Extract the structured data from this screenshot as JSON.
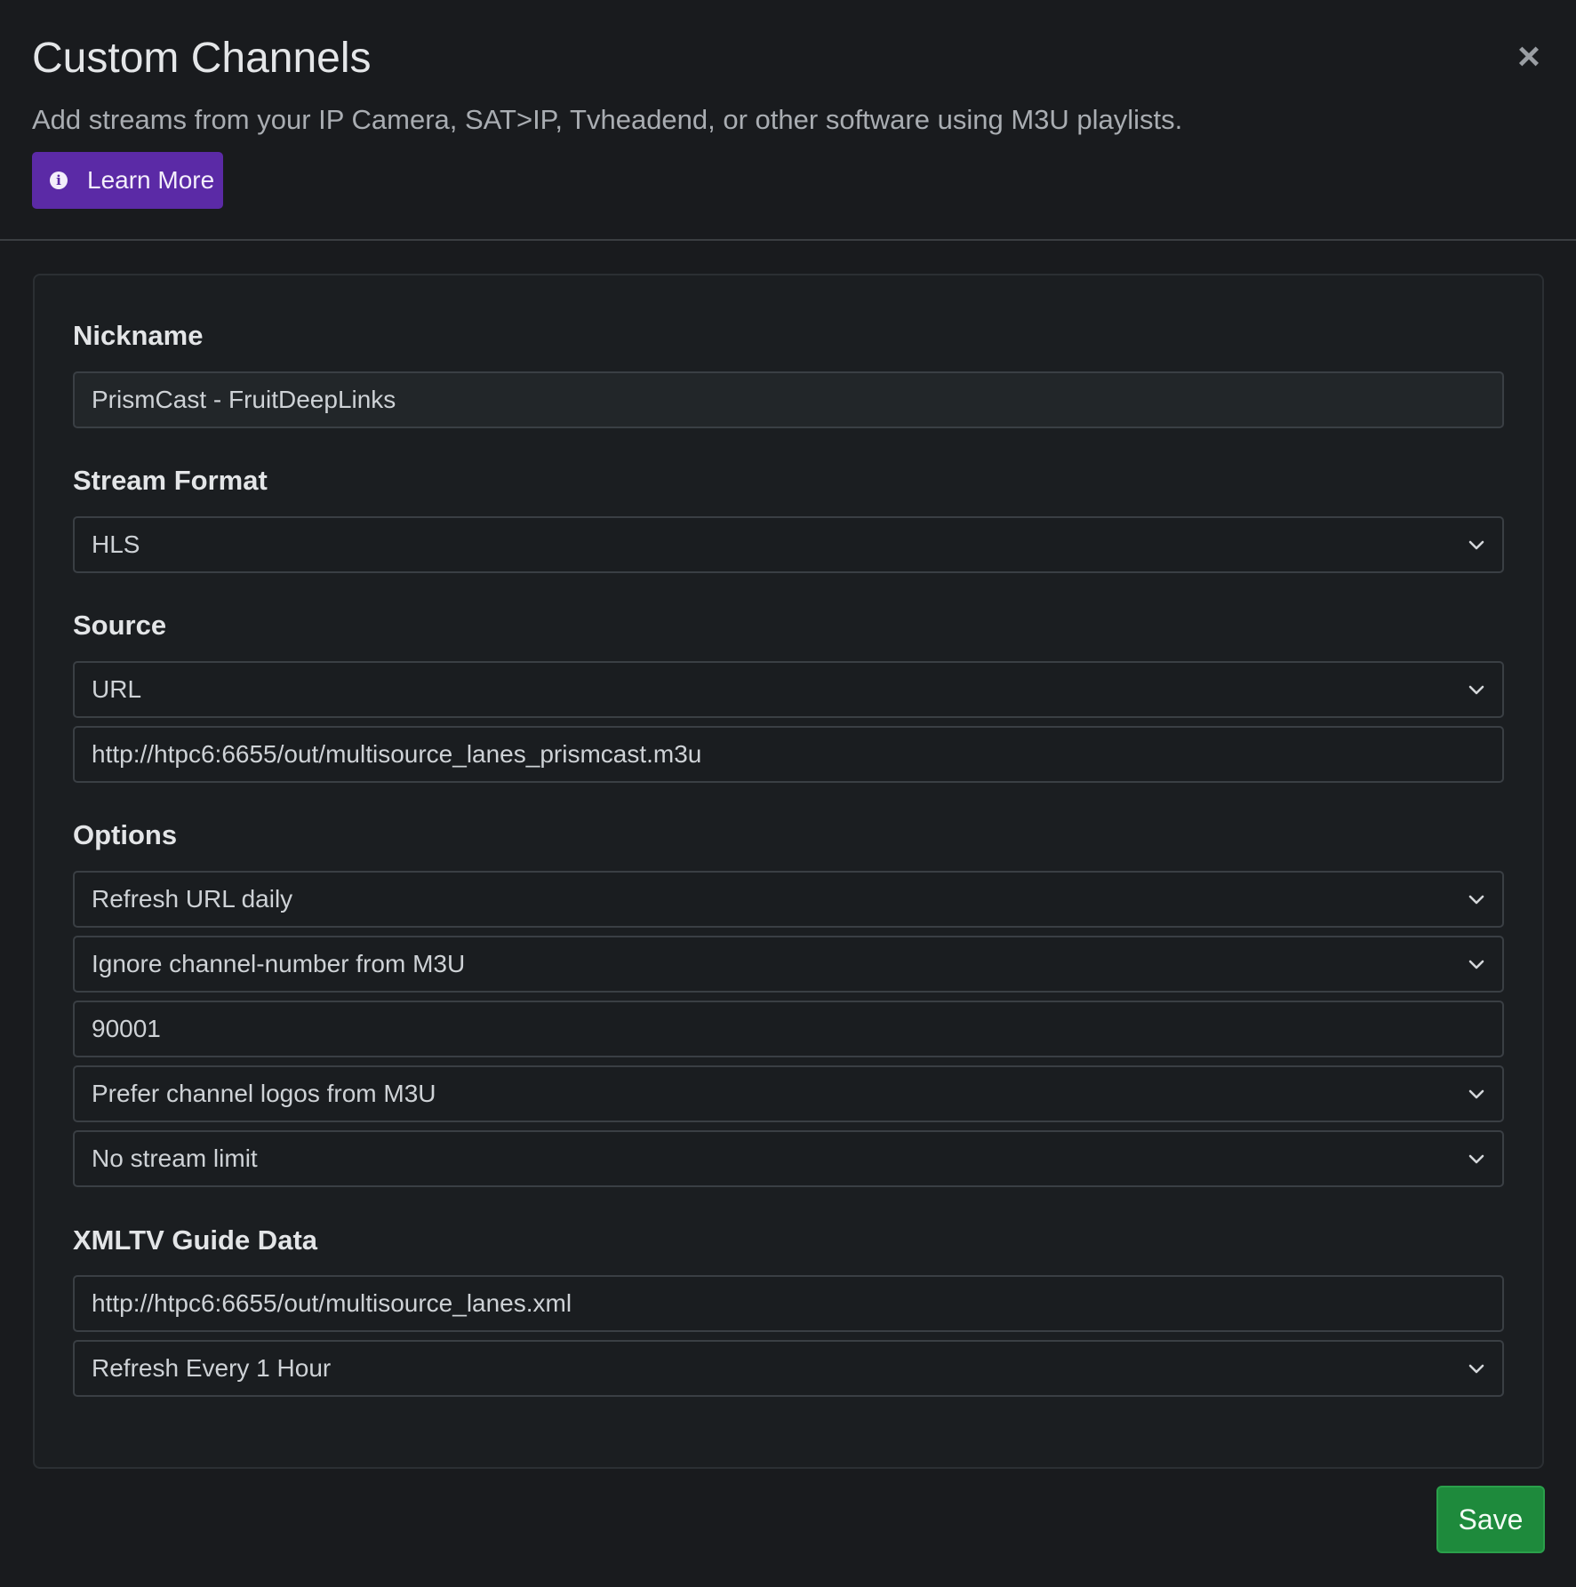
{
  "dialog": {
    "title": "Custom Channels",
    "close_glyph": "×",
    "subtitle": "Add streams from your IP Camera, SAT>IP, Tvheadend, or other software using M3U playlists.",
    "learn_more_label": "Learn More",
    "info_glyph": "i"
  },
  "form": {
    "nickname": {
      "label": "Nickname",
      "value": "PrismCast - FruitDeepLinks"
    },
    "stream_format": {
      "label": "Stream Format",
      "selected": "HLS"
    },
    "source": {
      "label": "Source",
      "selected": "URL",
      "url": "http://htpc6:6655/out/multisource_lanes_prismcast.m3u"
    },
    "options": {
      "label": "Options",
      "refresh": "Refresh URL daily",
      "channel_number_mode": "Ignore channel-number from M3U",
      "starting_number": "90001",
      "logos": "Prefer channel logos from M3U",
      "stream_limit": "No stream limit"
    },
    "xmltv": {
      "label": "XMLTV Guide Data",
      "url": "http://htpc6:6655/out/multisource_lanes.xml",
      "refresh": "Refresh Every 1 Hour"
    }
  },
  "footer": {
    "save_label": "Save"
  },
  "colors": {
    "background": "#191b1e",
    "accent_purple": "#5b2aa6",
    "save_green": "#1e8a3c"
  },
  "icons": [
    "close-icon",
    "info-icon",
    "chevron-down-icon"
  ]
}
